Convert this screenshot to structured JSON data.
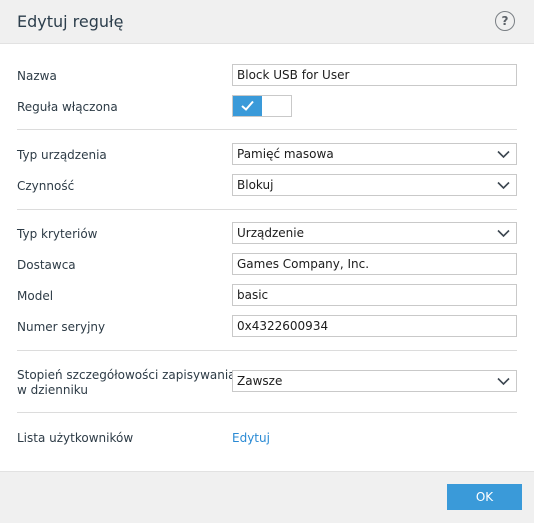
{
  "dialog": {
    "title": "Edytuj regułę",
    "help_icon": "?"
  },
  "fields": {
    "name": {
      "label": "Nazwa",
      "value": "Block USB for User"
    },
    "enabled": {
      "label": "Reguła włączona",
      "value": true
    },
    "device_type": {
      "label": "Typ urządzenia",
      "value": "Pamięć masowa"
    },
    "action": {
      "label": "Czynność",
      "value": "Blokuj"
    },
    "criteria_type": {
      "label": "Typ kryteriów",
      "value": "Urządzenie"
    },
    "vendor": {
      "label": "Dostawca",
      "value": "Games Company, Inc."
    },
    "model": {
      "label": "Model",
      "value": "basic"
    },
    "serial": {
      "label": "Numer seryjny",
      "value": "0x4322600934"
    },
    "logging": {
      "label_line1": "Stopień szczegółowości zapisywania",
      "label_line2": "w dzienniku",
      "value": "Zawsze"
    },
    "users": {
      "label": "Lista użytkowników",
      "link": "Edytuj"
    }
  },
  "footer": {
    "ok_label": "OK"
  },
  "colors": {
    "accent": "#3a9ad9",
    "link": "#2a8ad4",
    "header_bg": "#f0f0f0"
  }
}
